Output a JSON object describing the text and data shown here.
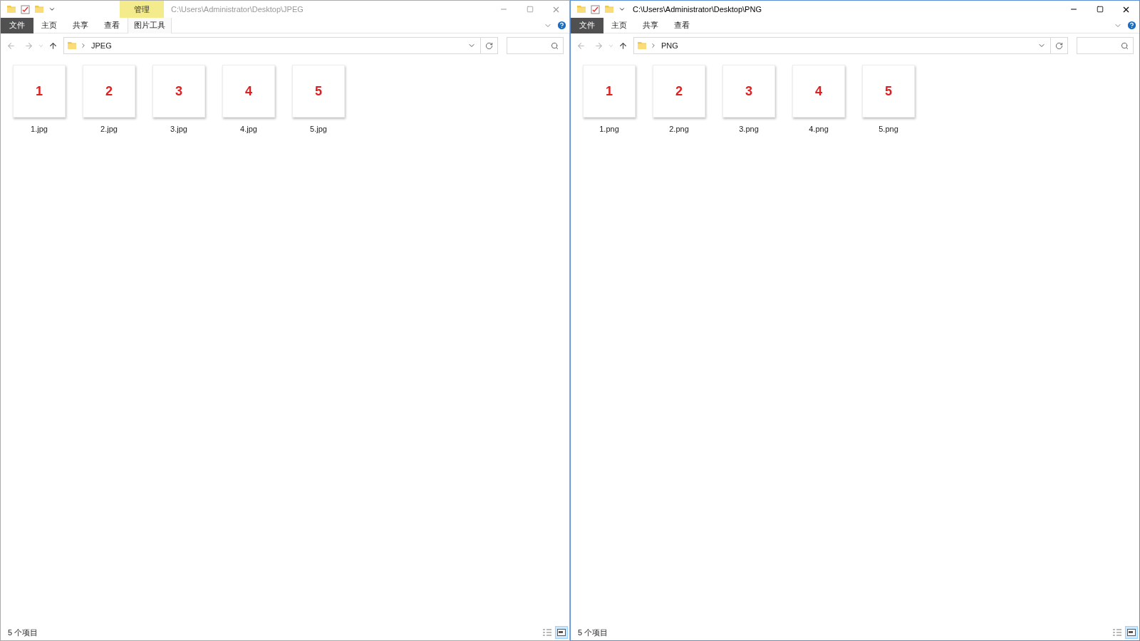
{
  "windows": [
    {
      "active": false,
      "contextual_tab": "管理",
      "title": "C:\\Users\\Administrator\\Desktop\\JPEG",
      "tabs": [
        {
          "label": "文件",
          "kind": "file"
        },
        {
          "label": "主页",
          "kind": "normal"
        },
        {
          "label": "共享",
          "kind": "normal"
        },
        {
          "label": "查看",
          "kind": "normal"
        },
        {
          "label": "图片工具",
          "kind": "contextual"
        }
      ],
      "address": "JPEG",
      "files": [
        {
          "thumb": "1",
          "name": "1.jpg"
        },
        {
          "thumb": "2",
          "name": "2.jpg"
        },
        {
          "thumb": "3",
          "name": "3.jpg"
        },
        {
          "thumb": "4",
          "name": "4.jpg"
        },
        {
          "thumb": "5",
          "name": "5.jpg"
        }
      ],
      "status": "5 个项目",
      "large_icons_view": true
    },
    {
      "active": true,
      "title": "C:\\Users\\Administrator\\Desktop\\PNG",
      "tabs": [
        {
          "label": "文件",
          "kind": "file"
        },
        {
          "label": "主页",
          "kind": "normal"
        },
        {
          "label": "共享",
          "kind": "normal"
        },
        {
          "label": "查看",
          "kind": "normal"
        }
      ],
      "address": "PNG",
      "files": [
        {
          "thumb": "1",
          "name": "1.png"
        },
        {
          "thumb": "2",
          "name": "2.png"
        },
        {
          "thumb": "3",
          "name": "3.png"
        },
        {
          "thumb": "4",
          "name": "4.png"
        },
        {
          "thumb": "5",
          "name": "5.png"
        }
      ],
      "status": "5 个项目",
      "large_icons_view": true
    }
  ]
}
